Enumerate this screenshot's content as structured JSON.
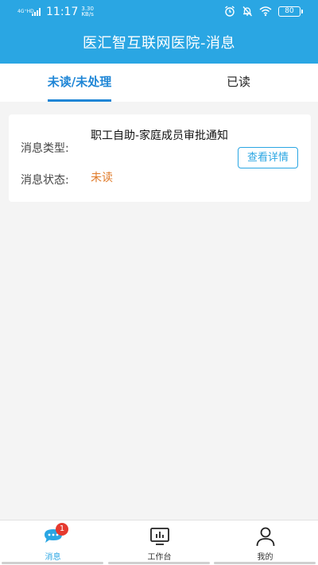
{
  "status_bar": {
    "network": "4G⁺HD",
    "time": "11:17",
    "speed_value": "3.30",
    "speed_unit": "KB/s",
    "battery": "80"
  },
  "header": {
    "title": "医汇智互联网医院-消息"
  },
  "tabs": [
    {
      "label": "未读/未处理",
      "active": true
    },
    {
      "label": "已读",
      "active": false
    }
  ],
  "message_card": {
    "type_label": "消息类型:",
    "type_value": "职工自助-家庭成员审批通知",
    "status_label": "消息状态:",
    "status_value": "未读",
    "detail_button": "查看详情",
    "status_color": "#e07b2a"
  },
  "bottom_nav": [
    {
      "label": "消息",
      "icon": "chat-icon",
      "badge": "1",
      "active": true
    },
    {
      "label": "工作台",
      "icon": "dashboard-icon",
      "active": false
    },
    {
      "label": "我的",
      "icon": "person-icon",
      "active": false
    }
  ],
  "colors": {
    "primary": "#2aa6e3",
    "tab_active": "#1f86d6",
    "badge": "#e53a2f"
  }
}
